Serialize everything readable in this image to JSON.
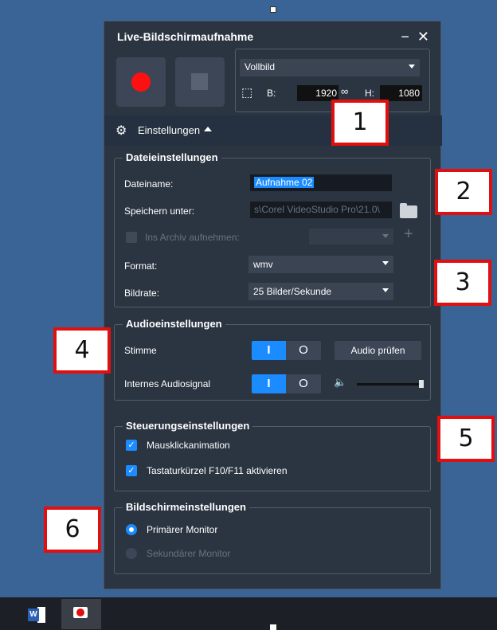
{
  "window": {
    "title": "Live-Bildschirmaufnahme",
    "minimize": "−",
    "close": "✕"
  },
  "capture": {
    "area_option": "Vollbild",
    "width_label": "B:",
    "width_value": "1920",
    "height_label": "H:",
    "height_value": "1080"
  },
  "settings": {
    "label": "Einstellungen"
  },
  "file_settings": {
    "title": "Dateieinstellungen",
    "filename_label": "Dateiname:",
    "filename_value": "Aufnahme 02",
    "save_label": "Speichern unter:",
    "save_value": "s\\Corel VideoStudio Pro\\21.0\\",
    "archive_label": "Ins Archiv aufnehmen:",
    "format_label": "Format:",
    "format_value": "wmv",
    "framerate_label": "Bildrate:",
    "framerate_value": "25 Bilder/Sekunde"
  },
  "audio_settings": {
    "title": "Audioeinstellungen",
    "voice_label": "Stimme",
    "internal_label": "Internes Audiosignal",
    "toggle_on": "I",
    "toggle_off": "O",
    "test_button": "Audio prüfen"
  },
  "control_settings": {
    "title": "Steuerungseinstellungen",
    "mouse_click": "Mausklickanimation",
    "shortcut": "Tastaturkürzel F10/F11 aktivieren"
  },
  "screen_settings": {
    "title": "Bildschirmeinstellungen",
    "primary": "Primärer Monitor",
    "secondary": "Sekundärer Monitor"
  },
  "callouts": [
    "1",
    "2",
    "3",
    "4",
    "5",
    "6"
  ],
  "icons": {
    "gear": "⚙",
    "select_area": "⬚",
    "link": "∞",
    "speaker": "🔈",
    "plus": "+"
  }
}
